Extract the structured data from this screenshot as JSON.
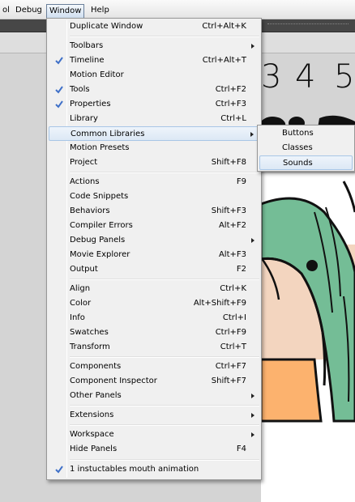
{
  "menubar": {
    "items": [
      {
        "label": "ol",
        "name": "menubar-item-tool"
      },
      {
        "label": "Debug",
        "name": "menubar-item-debug"
      },
      {
        "label": "Window",
        "name": "menubar-item-window"
      },
      {
        "label": "Help",
        "name": "menubar-item-help"
      }
    ]
  },
  "stage": {
    "numbers": [
      "3",
      "4",
      "5"
    ]
  },
  "window_menu": {
    "items": [
      {
        "label": "Duplicate Window",
        "shortcut": "Ctrl+Alt+K"
      },
      {
        "label": "Toolbars",
        "submenu": true
      },
      {
        "label": "Timeline",
        "shortcut": "Ctrl+Alt+T",
        "checked": true
      },
      {
        "label": "Motion Editor"
      },
      {
        "label": "Tools",
        "shortcut": "Ctrl+F2",
        "checked": true
      },
      {
        "label": "Properties",
        "shortcut": "Ctrl+F3",
        "checked": true
      },
      {
        "label": "Library",
        "shortcut": "Ctrl+L"
      },
      {
        "label": "Common Libraries",
        "submenu": true,
        "highlighted": true
      },
      {
        "label": "Motion Presets"
      },
      {
        "label": "Project",
        "shortcut": "Shift+F8"
      },
      {
        "label": "Actions",
        "shortcut": "F9"
      },
      {
        "label": "Code Snippets"
      },
      {
        "label": "Behaviors",
        "shortcut": "Shift+F3"
      },
      {
        "label": "Compiler Errors",
        "shortcut": "Alt+F2"
      },
      {
        "label": "Debug Panels",
        "submenu": true
      },
      {
        "label": "Movie Explorer",
        "shortcut": "Alt+F3"
      },
      {
        "label": "Output",
        "shortcut": "F2"
      },
      {
        "label": "Align",
        "shortcut": "Ctrl+K"
      },
      {
        "label": "Color",
        "shortcut": "Alt+Shift+F9"
      },
      {
        "label": "Info",
        "shortcut": "Ctrl+I"
      },
      {
        "label": "Swatches",
        "shortcut": "Ctrl+F9"
      },
      {
        "label": "Transform",
        "shortcut": "Ctrl+T"
      },
      {
        "label": "Components",
        "shortcut": "Ctrl+F7"
      },
      {
        "label": "Component Inspector",
        "shortcut": "Shift+F7"
      },
      {
        "label": "Other Panels",
        "submenu": true
      },
      {
        "label": "Extensions",
        "submenu": true
      },
      {
        "label": "Workspace",
        "submenu": true
      },
      {
        "label": "Hide Panels",
        "shortcut": "F4"
      },
      {
        "label": "1 instuctables mouth animation",
        "checked": true
      }
    ]
  },
  "common_libraries_submenu": {
    "items": [
      {
        "label": "Buttons"
      },
      {
        "label": "Classes"
      },
      {
        "label": "Sounds",
        "highlighted": true
      }
    ]
  },
  "colors": {
    "hair_green": "#74bd96",
    "skin": "#f3d5bf",
    "shirt_orange": "#fcb26e",
    "highlight": "#dce8f5"
  }
}
